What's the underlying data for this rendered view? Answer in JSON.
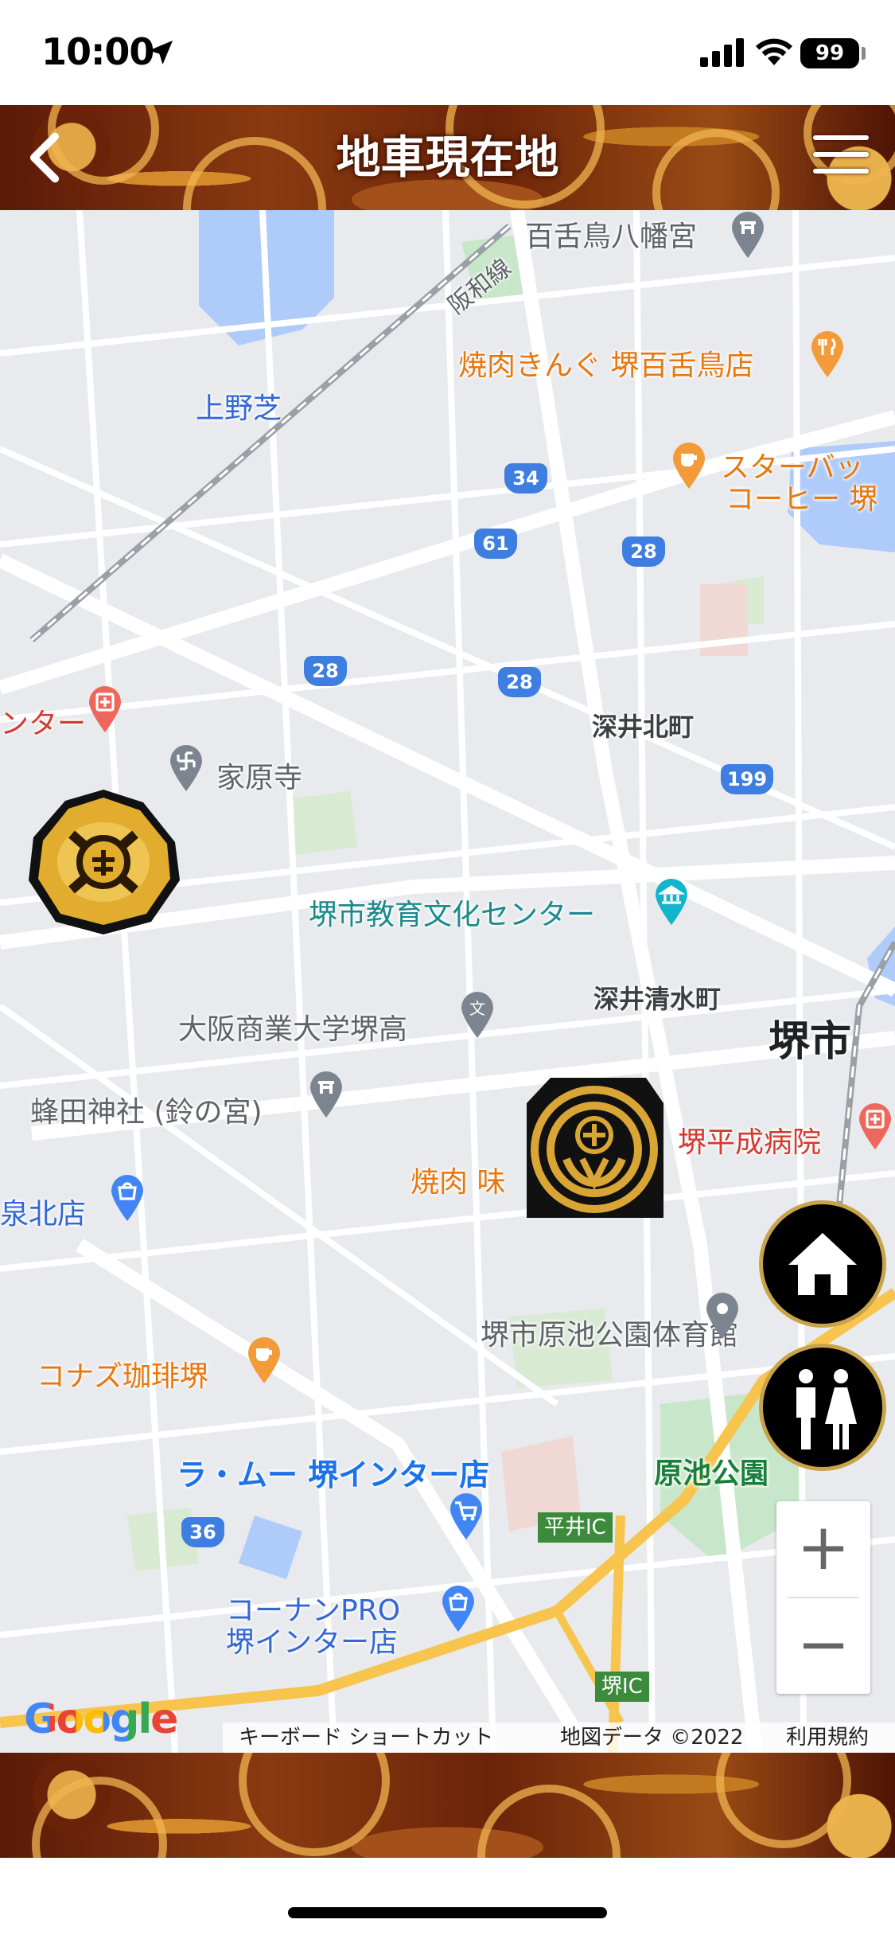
{
  "status_bar": {
    "time": "10:00",
    "battery": "99"
  },
  "header": {
    "title": "地車現在地"
  },
  "map": {
    "labels": {
      "mozu_hachimangu": "百舌鳥八幡宮",
      "yakiniku_kingu": "焼肉きんぐ 堺百舌鳥店",
      "starbucks_1": "スターバッ",
      "starbucks_2": "コーヒー 堺",
      "kaminoshiba": "上野芝",
      "hanwa_line": "阪和線",
      "center_partial": "ンター",
      "kaharaji": "家原寺",
      "fukai_kitamachi": "深井北町",
      "kyoiku_center": "堺市教育文化センター",
      "fukai_shimizucho": "深井清水町",
      "sakai_shi": "堺市",
      "osaka_shogyo": "大阪商業大学堺高",
      "hachida_jinja": "蜂田神社 (鈴の宮)",
      "sakai_heisei": "堺平成病院",
      "yakiniku_aji": "焼肉 味",
      "izumi_kita": "泉北店",
      "haraike_gym": "堺市原池公園体育館",
      "konazu": "コナズ珈琲堺",
      "haraike_park": "原池公園",
      "lamu_1": "ラ・ムー 堺インター店",
      "hirai_ic": "平井IC",
      "kohnan_1": "コーナンPRO",
      "kohnan_2": "堺インター店",
      "sakai_ic": "堺IC"
    },
    "route_shields": [
      "34",
      "61",
      "28",
      "28",
      "28",
      "199",
      "36"
    ],
    "google": "Google",
    "attribution": {
      "shortcuts": "キーボード ショートカット",
      "map_data": "地図データ ©2022",
      "terms": "利用規約"
    },
    "zoom_in": "+",
    "zoom_out": "−"
  },
  "colors": {
    "header_brown": "#6b2409",
    "gold": "#c9a34a",
    "map_bg": "#e8eaed",
    "water": "#aecbfa",
    "park": "#c8e6c9"
  },
  "icons": [
    "location-arrow-icon",
    "signal-icon",
    "wifi-icon",
    "back-chevron-icon",
    "hamburger-menu-icon",
    "home-icon",
    "restroom-icon",
    "danjiri-crest-marker"
  ]
}
